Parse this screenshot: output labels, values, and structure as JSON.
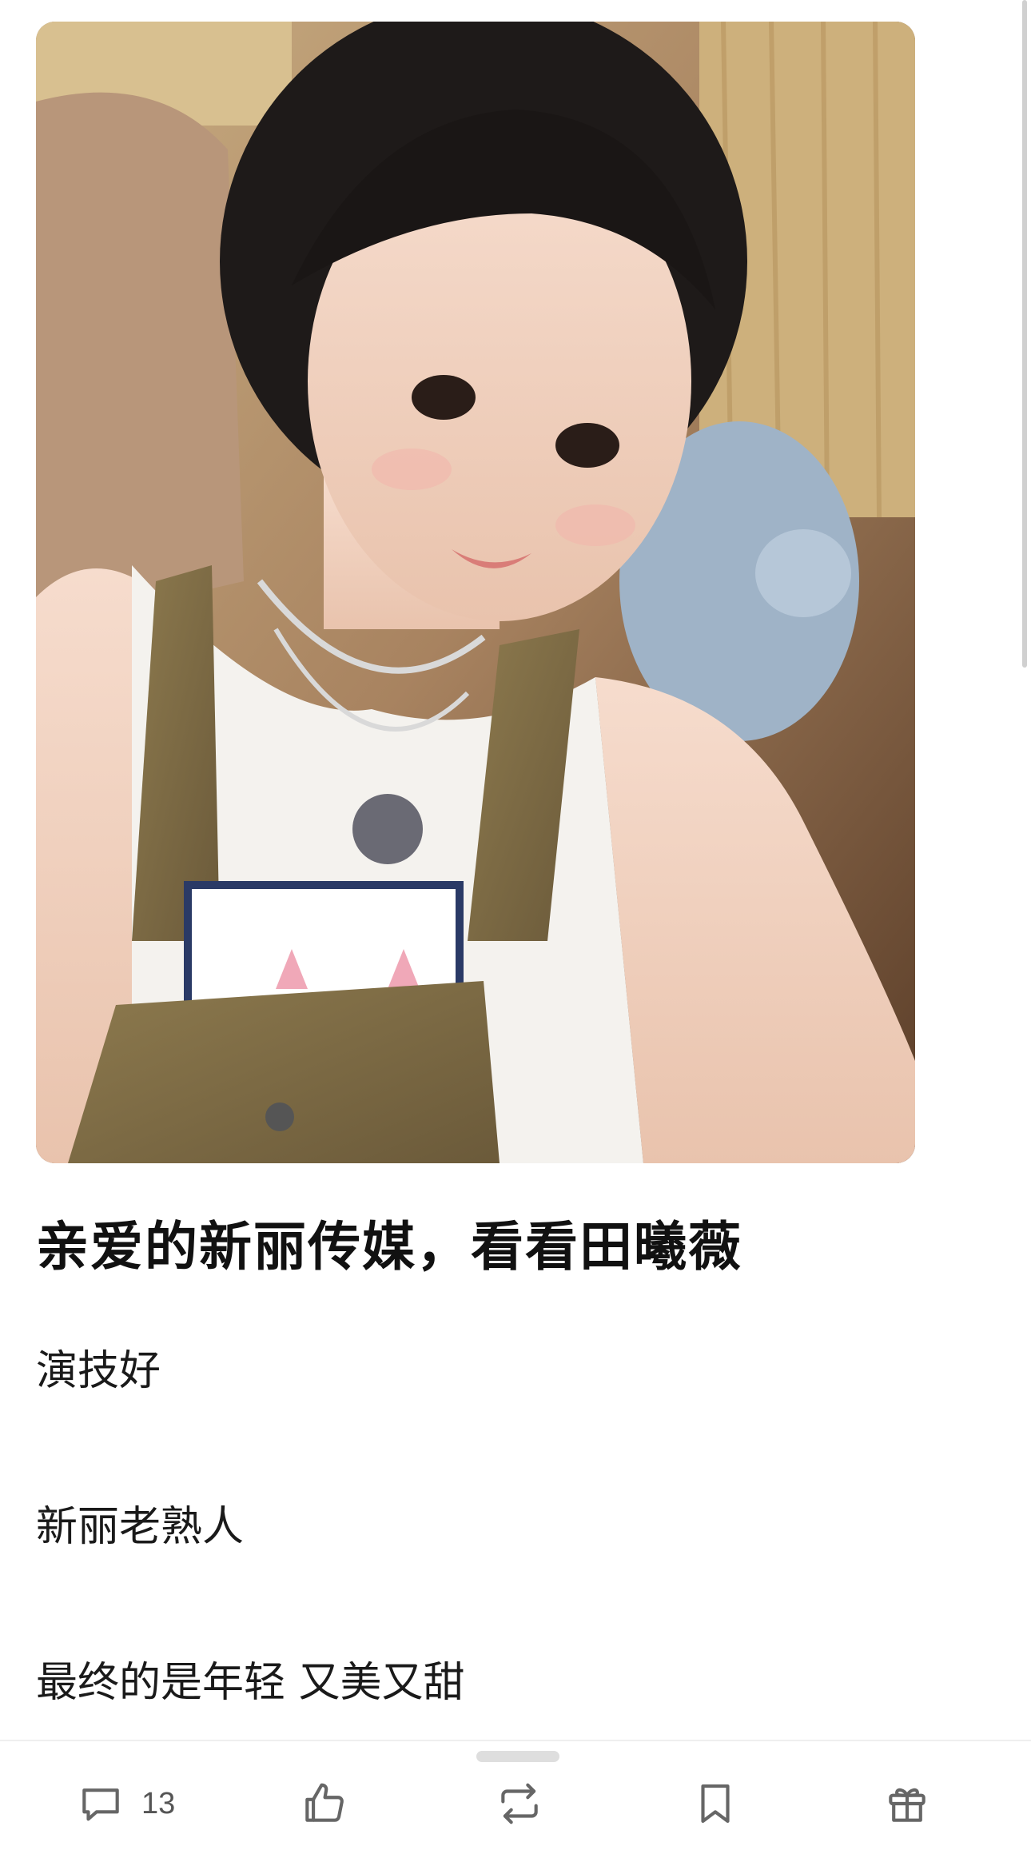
{
  "post": {
    "image_alt": "photo",
    "title": "亲爱的新丽传媒，看看田曦薇",
    "paragraphs": [
      "演技好",
      "新丽老熟人",
      "最终的是年轻 又美又甜"
    ]
  },
  "actions": {
    "comment": {
      "icon": "comment-icon",
      "count": "13"
    },
    "like": {
      "icon": "thumbs-up-icon"
    },
    "repost": {
      "icon": "repost-icon"
    },
    "favorite": {
      "icon": "bookmark-icon"
    },
    "gift": {
      "icon": "gift-icon"
    }
  },
  "colors": {
    "icon": "#666666",
    "text": "#111111",
    "background": "#ffffff"
  }
}
